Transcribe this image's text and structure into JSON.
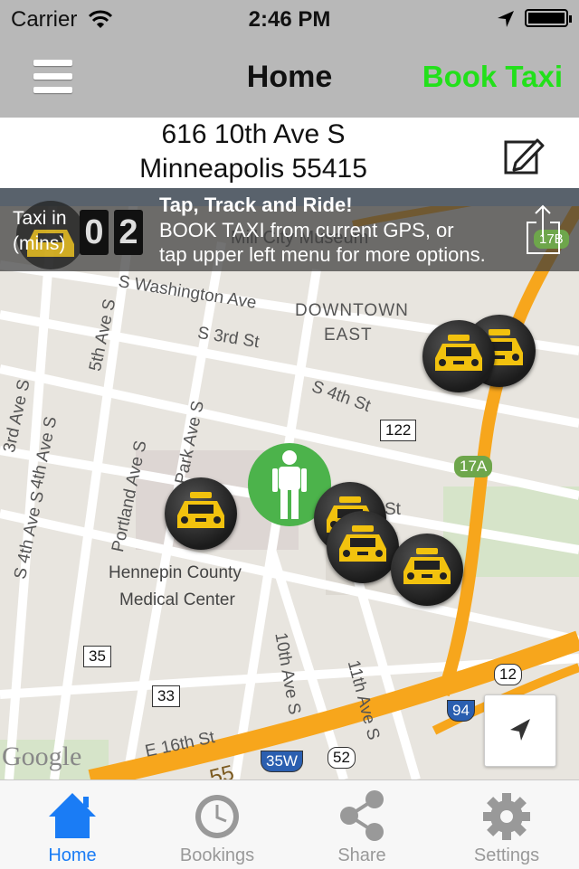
{
  "status_bar": {
    "carrier": "Carrier",
    "time": "2:46 PM"
  },
  "nav": {
    "title": "Home",
    "book_label": "Book Taxi",
    "book_color": "#22e01a"
  },
  "address": {
    "line1": "616 10th Ave S",
    "line2": "Minneapolis 55415"
  },
  "banner": {
    "taxi_in_label": "Taxi in",
    "mins_label": "(mins)",
    "digit1": "0",
    "digit2": "2",
    "headline": "Tap, Track and Ride!",
    "line1": "BOOK TAXI from current GPS, or",
    "line2": "tap upper left menu for more options."
  },
  "map": {
    "labels": {
      "s_washington_ave": "S Washington Ave",
      "downtown": "DOWNTOWN",
      "east": "EAST",
      "s_3rd_st": "S 3rd St",
      "s_4th_st": "S 4th St",
      "st": "St",
      "fifth_ave_s": "5th Ave S",
      "third_ave_s": "3rd Ave S",
      "fourth_ave_s": "4th Ave S",
      "s_4th_ave_s": "S 4th Ave S",
      "portland_ave_s": "Portland Ave S",
      "park_ave_s": "Park Ave S",
      "hospital_line1": "Hennepin County",
      "hospital_line2": "Medical Center",
      "tenth_ave_s": "10th Ave S",
      "eleventh_ave_s": "11th Ave S",
      "e_16th_st": "E 16th St",
      "museum": "Mill City Museum",
      "i55": "55",
      "google": "Google"
    },
    "shields": {
      "r122": "122",
      "r17a": "17A",
      "r35": "35",
      "r33": "33",
      "r94": "94",
      "r12": "12",
      "r35w": "35W",
      "r52": "52",
      "r17b": "17B"
    },
    "colors": {
      "highway": "#f7a61c",
      "road": "#ffffff",
      "user_marker": "#4cb34b",
      "tab_active": "#1a7cf5"
    }
  },
  "tabs": [
    {
      "label": "Home",
      "icon": "home-icon",
      "active": true
    },
    {
      "label": "Bookings",
      "icon": "clock-icon",
      "active": false
    },
    {
      "label": "Share",
      "icon": "share-icon",
      "active": false
    },
    {
      "label": "Settings",
      "icon": "gear-icon",
      "active": false
    }
  ]
}
